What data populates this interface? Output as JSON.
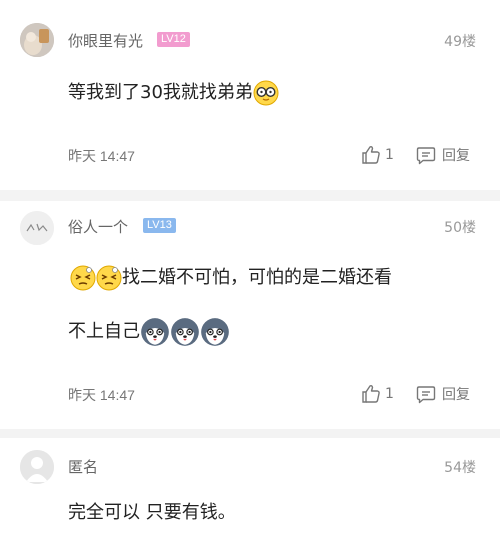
{
  "comments": [
    {
      "username": "你眼里有光",
      "level": "LV12",
      "level_color": "#f29ccf",
      "floor": "49楼",
      "text": "等我到了30我就找弟弟",
      "emoji_after": "nerd-glasses-emoji",
      "time": "昨天 14:47",
      "likes": "1",
      "reply_label": "回复"
    },
    {
      "username": "俗人一个",
      "level": "LV13",
      "level_color": "#8ab8ee",
      "floor": "50楼",
      "emoji_before": [
        "dizzy-face-emoji",
        "dizzy-face-emoji"
      ],
      "text_line1": "找二婚不可怕，可怕的是二婚还看",
      "text_line2": "不上自己",
      "emoji_after": [
        "husky-emoji",
        "husky-emoji",
        "husky-emoji"
      ],
      "time": "昨天 14:47",
      "likes": "1",
      "reply_label": "回复"
    },
    {
      "username": "匿名",
      "floor": "54楼",
      "text": "完全可以 只要有钱。"
    }
  ]
}
